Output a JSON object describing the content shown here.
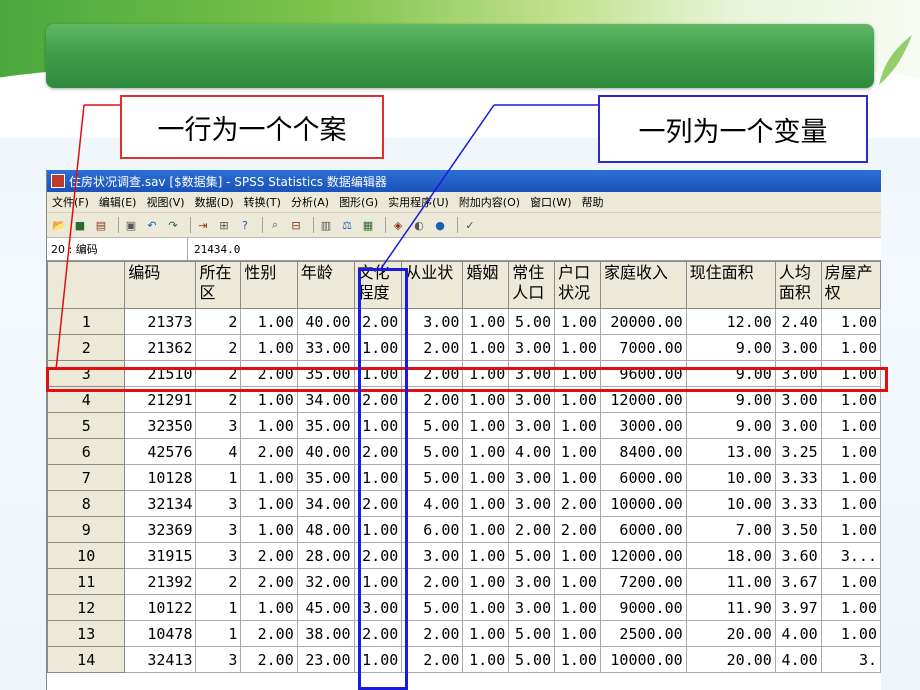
{
  "slide": {
    "row_callout": "一行为一个个案",
    "col_callout": "一列为一个变量"
  },
  "window": {
    "title": "住房状况调查.sav [$数据集] - SPSS Statistics 数据编辑器",
    "menus": [
      "文件(F)",
      "编辑(E)",
      "视图(V)",
      "数据(D)",
      "转换(T)",
      "分析(A)",
      "图形(G)",
      "实用程序(U)",
      "附加内容(O)",
      "窗口(W)",
      "帮助"
    ],
    "toolbar_icons": [
      "open-icon",
      "save-icon",
      "print-icon",
      "dialog-recall-icon",
      "undo-icon",
      "redo-icon",
      "goto-case-icon",
      "insert-case-icon",
      "variables-icon",
      "find-icon",
      "insert-variable-icon",
      "split-file-icon",
      "weight-cases-icon",
      "select-cases-icon",
      "value-labels-icon",
      "use-sets-icon",
      "show-all-icon",
      "spelling-icon"
    ],
    "cell_ref": "20 : 编码",
    "cell_value": "21434.0"
  },
  "table": {
    "headers": [
      "",
      "编码",
      "所在区",
      "性别",
      "年龄",
      "文化程度",
      "从业状",
      "婚姻",
      "常住人口",
      "户口状况",
      "家庭收入",
      "现住面积",
      "人均面积",
      "房屋产权"
    ],
    "rows": [
      [
        "1",
        "21373",
        "2",
        "1.00",
        "40.00",
        "2.00",
        "3.00",
        "1.00",
        "5.00",
        "1.00",
        "20000.00",
        "12.00",
        "2.40",
        "1.00"
      ],
      [
        "2",
        "21362",
        "2",
        "1.00",
        "33.00",
        "1.00",
        "2.00",
        "1.00",
        "3.00",
        "1.00",
        "7000.00",
        "9.00",
        "3.00",
        "1.00"
      ],
      [
        "3",
        "21510",
        "2",
        "2.00",
        "35.00",
        "1.00",
        "2.00",
        "1.00",
        "3.00",
        "1.00",
        "9600.00",
        "9.00",
        "3.00",
        "1.00"
      ],
      [
        "4",
        "21291",
        "2",
        "1.00",
        "34.00",
        "2.00",
        "2.00",
        "1.00",
        "3.00",
        "1.00",
        "12000.00",
        "9.00",
        "3.00",
        "1.00"
      ],
      [
        "5",
        "32350",
        "3",
        "1.00",
        "35.00",
        "1.00",
        "5.00",
        "1.00",
        "3.00",
        "1.00",
        "3000.00",
        "9.00",
        "3.00",
        "1.00"
      ],
      [
        "6",
        "42576",
        "4",
        "2.00",
        "40.00",
        "2.00",
        "5.00",
        "1.00",
        "4.00",
        "1.00",
        "8400.00",
        "13.00",
        "3.25",
        "1.00"
      ],
      [
        "7",
        "10128",
        "1",
        "1.00",
        "35.00",
        "1.00",
        "5.00",
        "1.00",
        "3.00",
        "1.00",
        "6000.00",
        "10.00",
        "3.33",
        "1.00"
      ],
      [
        "8",
        "32134",
        "3",
        "1.00",
        "34.00",
        "2.00",
        "4.00",
        "1.00",
        "3.00",
        "2.00",
        "10000.00",
        "10.00",
        "3.33",
        "1.00"
      ],
      [
        "9",
        "32369",
        "3",
        "1.00",
        "48.00",
        "1.00",
        "6.00",
        "1.00",
        "2.00",
        "2.00",
        "6000.00",
        "7.00",
        "3.50",
        "1.00"
      ],
      [
        "10",
        "31915",
        "3",
        "2.00",
        "28.00",
        "2.00",
        "3.00",
        "1.00",
        "5.00",
        "1.00",
        "12000.00",
        "18.00",
        "3.60",
        "3..."
      ],
      [
        "11",
        "21392",
        "2",
        "2.00",
        "32.00",
        "1.00",
        "2.00",
        "1.00",
        "3.00",
        "1.00",
        "7200.00",
        "11.00",
        "3.67",
        "1.00"
      ],
      [
        "12",
        "10122",
        "1",
        "1.00",
        "45.00",
        "3.00",
        "5.00",
        "1.00",
        "3.00",
        "1.00",
        "9000.00",
        "11.90",
        "3.97",
        "1.00"
      ],
      [
        "13",
        "10478",
        "1",
        "2.00",
        "38.00",
        "2.00",
        "2.00",
        "1.00",
        "5.00",
        "1.00",
        "2500.00",
        "20.00",
        "4.00",
        "1.00"
      ],
      [
        "14",
        "32413",
        "3",
        "2.00",
        "23.00",
        "1.00",
        "2.00",
        "1.00",
        "5.00",
        "1.00",
        "10000.00",
        "20.00",
        "4.00",
        "3."
      ]
    ]
  },
  "colors": {
    "row_highlight": "#e01010",
    "col_highlight": "#1a1ae0",
    "banner": "#3f9f4a"
  }
}
